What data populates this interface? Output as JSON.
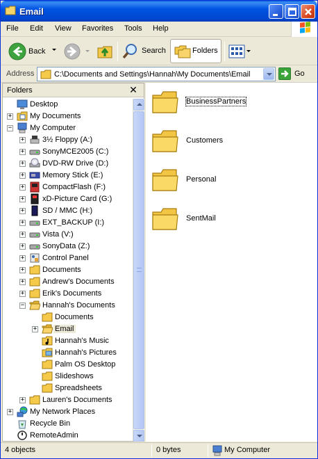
{
  "window": {
    "title": "Email"
  },
  "menu": [
    "File",
    "Edit",
    "View",
    "Favorites",
    "Tools",
    "Help"
  ],
  "toolbar": {
    "back_label": "Back",
    "search_label": "Search",
    "folders_label": "Folders"
  },
  "address": {
    "label": "Address",
    "value": "C:\\Documents and Settings\\Hannah\\My Documents\\Email",
    "go_label": "Go"
  },
  "folders_pane": {
    "header": "Folders",
    "close_glyph": "✕",
    "tree": [
      {
        "label": "Desktop",
        "icon": "desktop-icon",
        "exp": ""
      },
      {
        "label": "My Documents",
        "icon": "my-documents-icon",
        "exp": "+"
      },
      {
        "label": "My Computer",
        "icon": "my-computer-icon",
        "exp": "−"
      },
      {
        "label": "3½ Floppy (A:)",
        "icon": "floppy-drive-icon",
        "exp": "+"
      },
      {
        "label": "SonyMCE2005 (C:)",
        "icon": "hard-drive-icon",
        "exp": "+"
      },
      {
        "label": "DVD-RW Drive (D:)",
        "icon": "dvd-drive-icon",
        "exp": "+"
      },
      {
        "label": "Memory Stick (E:)",
        "icon": "memory-stick-icon",
        "exp": "+"
      },
      {
        "label": "CompactFlash (F:)",
        "icon": "compactflash-icon",
        "exp": "+"
      },
      {
        "label": "xD-Picture Card (G:)",
        "icon": "xd-card-icon",
        "exp": "+"
      },
      {
        "label": "SD / MMC (H:)",
        "icon": "sd-card-icon",
        "exp": "+"
      },
      {
        "label": "EXT_BACKUP (I:)",
        "icon": "hard-drive-icon",
        "exp": "+"
      },
      {
        "label": "Vista (V:)",
        "icon": "hard-drive-icon",
        "exp": "+"
      },
      {
        "label": "SonyData (Z:)",
        "icon": "hard-drive-icon",
        "exp": "+"
      },
      {
        "label": "Control Panel",
        "icon": "control-panel-icon",
        "exp": "+"
      },
      {
        "label": "Documents",
        "icon": "folder-icon",
        "exp": "+"
      },
      {
        "label": "Andrew's Documents",
        "icon": "folder-icon",
        "exp": "+"
      },
      {
        "label": "Erik's Documents",
        "icon": "folder-icon",
        "exp": "+"
      },
      {
        "label": "Hannah's Documents",
        "icon": "folder-open-icon",
        "exp": "−"
      },
      {
        "label": "Documents",
        "icon": "folder-icon",
        "exp": ""
      },
      {
        "label": "Email",
        "icon": "folder-open-icon",
        "exp": "+"
      },
      {
        "label": "Hannah's Music",
        "icon": "music-folder-icon",
        "exp": ""
      },
      {
        "label": "Hannah's Pictures",
        "icon": "pictures-folder-icon",
        "exp": ""
      },
      {
        "label": "Palm OS Desktop",
        "icon": "folder-icon",
        "exp": ""
      },
      {
        "label": "Slideshows",
        "icon": "folder-icon",
        "exp": ""
      },
      {
        "label": "Spreadsheets",
        "icon": "folder-icon",
        "exp": ""
      },
      {
        "label": "Lauren's Documents",
        "icon": "folder-icon",
        "exp": "+"
      },
      {
        "label": "My Network Places",
        "icon": "network-places-icon",
        "exp": "+"
      },
      {
        "label": "Recycle Bin",
        "icon": "recycle-bin-icon",
        "exp": ""
      },
      {
        "label": "RemoteAdmin",
        "icon": "remote-admin-icon",
        "exp": ""
      }
    ]
  },
  "files": [
    {
      "label": "BusinessPartners"
    },
    {
      "label": "Customers"
    },
    {
      "label": "Personal"
    },
    {
      "label": "SentMail"
    }
  ],
  "status": {
    "objects": "4 objects",
    "size": "0 bytes",
    "location": "My Computer"
  },
  "colors": {
    "titlebar": "#0054e3",
    "folder": "#f5c94a",
    "selected_bg": "#ece9d8"
  }
}
